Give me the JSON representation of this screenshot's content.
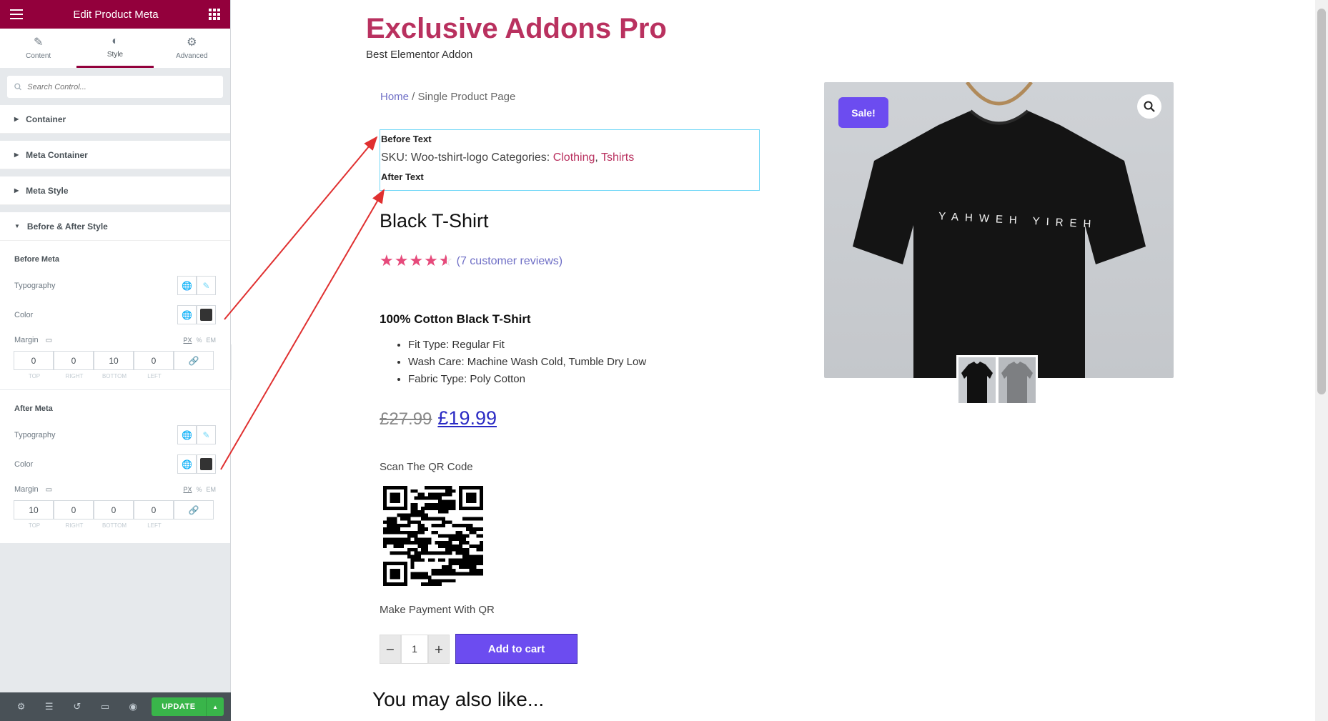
{
  "panel": {
    "title": "Edit Product Meta",
    "tabs": [
      {
        "label": "Content",
        "icon": "pencil-icon"
      },
      {
        "label": "Style",
        "icon": "contrast-icon"
      },
      {
        "label": "Advanced",
        "icon": "gear-icon"
      }
    ],
    "search_placeholder": "Search Control...",
    "sections": [
      "Container",
      "Meta Container",
      "Meta Style",
      "Before & After Style"
    ],
    "before_meta": {
      "heading": "Before Meta",
      "typography_label": "Typography",
      "color_label": "Color",
      "margin_label": "Margin",
      "units": [
        "PX",
        "%",
        "EM"
      ],
      "margin": {
        "top": "0",
        "right": "0",
        "bottom": "10",
        "left": "0"
      }
    },
    "after_meta": {
      "heading": "After Meta",
      "typography_label": "Typography",
      "color_label": "Color",
      "margin_label": "Margin",
      "units": [
        "PX",
        "%",
        "EM"
      ],
      "margin": {
        "top": "10",
        "right": "0",
        "bottom": "0",
        "left": "0"
      }
    },
    "dim_labels": [
      "TOP",
      "RIGHT",
      "BOTTOM",
      "LEFT"
    ],
    "color_swatch": "#333333",
    "accent": "#93003c",
    "update_label": "UPDATE"
  },
  "site": {
    "title": "Exclusive Addons Pro",
    "tagline": "Best Elementor Addon",
    "breadcrumb_home": "Home",
    "breadcrumb_sep": " / ",
    "breadcrumb_current": "Single Product Page"
  },
  "product": {
    "before_text": "Before Text",
    "sku_prefix": "SKU: Woo-tshirt-logo Categories: ",
    "category_1": "Clothing",
    "category_sep": ", ",
    "category_2": "Tshirts",
    "after_text": "After Text",
    "title": "Black T-Shirt",
    "rating": 4.5,
    "reviews": "(7 customer reviews)",
    "desc_title": "100% Cotton Black T-Shirt",
    "features": [
      "Fit Type: Regular Fit",
      "Wash Care: Machine Wash Cold, Tumble Dry Low",
      "Fabric Type: Poly Cotton"
    ],
    "old_price": "£27.99",
    "new_price": "£19.99",
    "qr_label": "Scan The QR Code",
    "payment_label": "Make Payment With QR",
    "quantity": "1",
    "add_to_cart": "Add to cart",
    "sale_badge": "Sale!",
    "shirt_print": "YAHWEH YIREH",
    "also_like": "You may also like..."
  }
}
